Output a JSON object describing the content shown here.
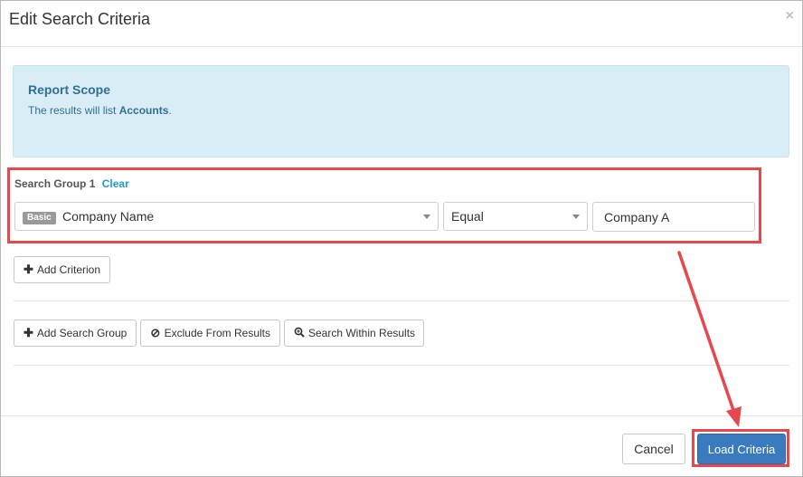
{
  "modal": {
    "title": "Edit Search Criteria",
    "close_glyph": "×"
  },
  "scope": {
    "title": "Report Scope",
    "text_prefix": "The results will list ",
    "text_entity": "Accounts",
    "text_suffix": "."
  },
  "group": {
    "label": "Search Group 1",
    "clear_label": "Clear",
    "criterion": {
      "badge": "Basic",
      "field": "Company Name",
      "operator": "Equal",
      "value": "Company A"
    }
  },
  "buttons": {
    "add_criterion": "Add Criterion",
    "add_search_group": "Add Search Group",
    "exclude_from_results": "Exclude From Results",
    "search_within_results": "Search Within Results",
    "cancel": "Cancel",
    "load_criteria": "Load Criteria"
  },
  "icons": {
    "plus": "plus-icon",
    "ban": "ban-icon",
    "zoom": "zoom-in-icon"
  },
  "colors": {
    "highlight": "#e8474d",
    "primary": "#3a7bbf",
    "info_bg": "#d9edf7",
    "info_text": "#31708f",
    "link": "#1a9fd0"
  }
}
